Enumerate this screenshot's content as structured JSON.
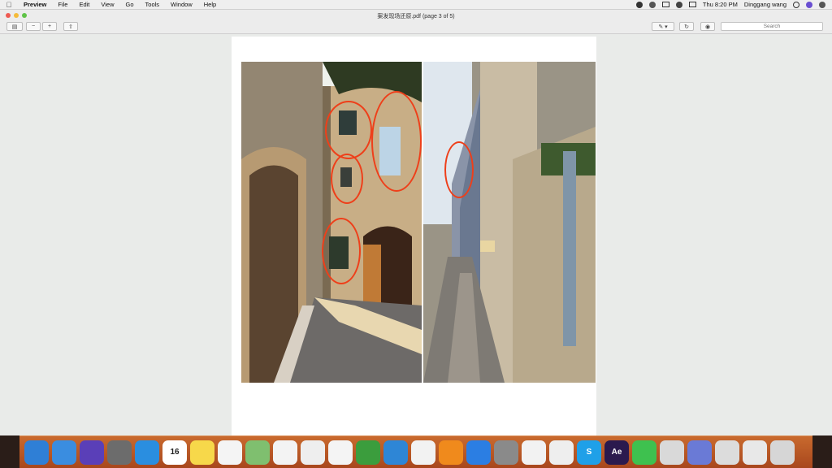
{
  "menubar": {
    "items": [
      "Preview",
      "File",
      "Edit",
      "View",
      "Go",
      "Tools",
      "Window",
      "Help"
    ],
    "clock": "Thu 8:20 PM",
    "user": "Dinggang wang"
  },
  "window": {
    "title": "案发现场还原.pdf (page 3 of 5)",
    "toolbar": {
      "search_placeholder": "Search"
    }
  },
  "dock": {
    "items": [
      {
        "name": "safari",
        "color": "#2f7fd6"
      },
      {
        "name": "finder",
        "color": "#3a8de0"
      },
      {
        "name": "siri",
        "color": "#5a3fb8"
      },
      {
        "name": "launchpad",
        "color": "#6c6c6c"
      },
      {
        "name": "safari-2",
        "color": "#2a8ee0"
      },
      {
        "name": "calendar",
        "color": "#ffffff",
        "label": "16"
      },
      {
        "name": "notes",
        "color": "#f7d84a"
      },
      {
        "name": "reminders",
        "color": "#f4f4f4"
      },
      {
        "name": "maps",
        "color": "#7fbf6f"
      },
      {
        "name": "photos",
        "color": "#f3f3f3"
      },
      {
        "name": "messages",
        "color": "#eeeeee"
      },
      {
        "name": "sketch",
        "color": "#f4f4f4"
      },
      {
        "name": "numbers",
        "color": "#3b9d3d"
      },
      {
        "name": "keynote",
        "color": "#2e86d6"
      },
      {
        "name": "itunes",
        "color": "#f2f2f2"
      },
      {
        "name": "ibooks",
        "color": "#f08a1c"
      },
      {
        "name": "app-store",
        "color": "#2b7ee3"
      },
      {
        "name": "system-preferences",
        "color": "#8a8a8a"
      },
      {
        "name": "chrome",
        "color": "#f2f2f2"
      },
      {
        "name": "mouse-app",
        "color": "#eeeeee"
      },
      {
        "name": "skype",
        "color": "#1fa0e8",
        "label": "S"
      },
      {
        "name": "after-effects",
        "color": "#2b1a4e",
        "label": "Ae"
      },
      {
        "name": "whatsapp",
        "color": "#3ec14f"
      },
      {
        "name": "image-capture",
        "color": "#d9d9d9"
      },
      {
        "name": "discord",
        "color": "#6a7ad6"
      },
      {
        "name": "preview",
        "color": "#dcdcdc"
      },
      {
        "name": "folder",
        "color": "#e8e8e8"
      },
      {
        "name": "trash",
        "color": "#d6d6d6"
      }
    ]
  }
}
